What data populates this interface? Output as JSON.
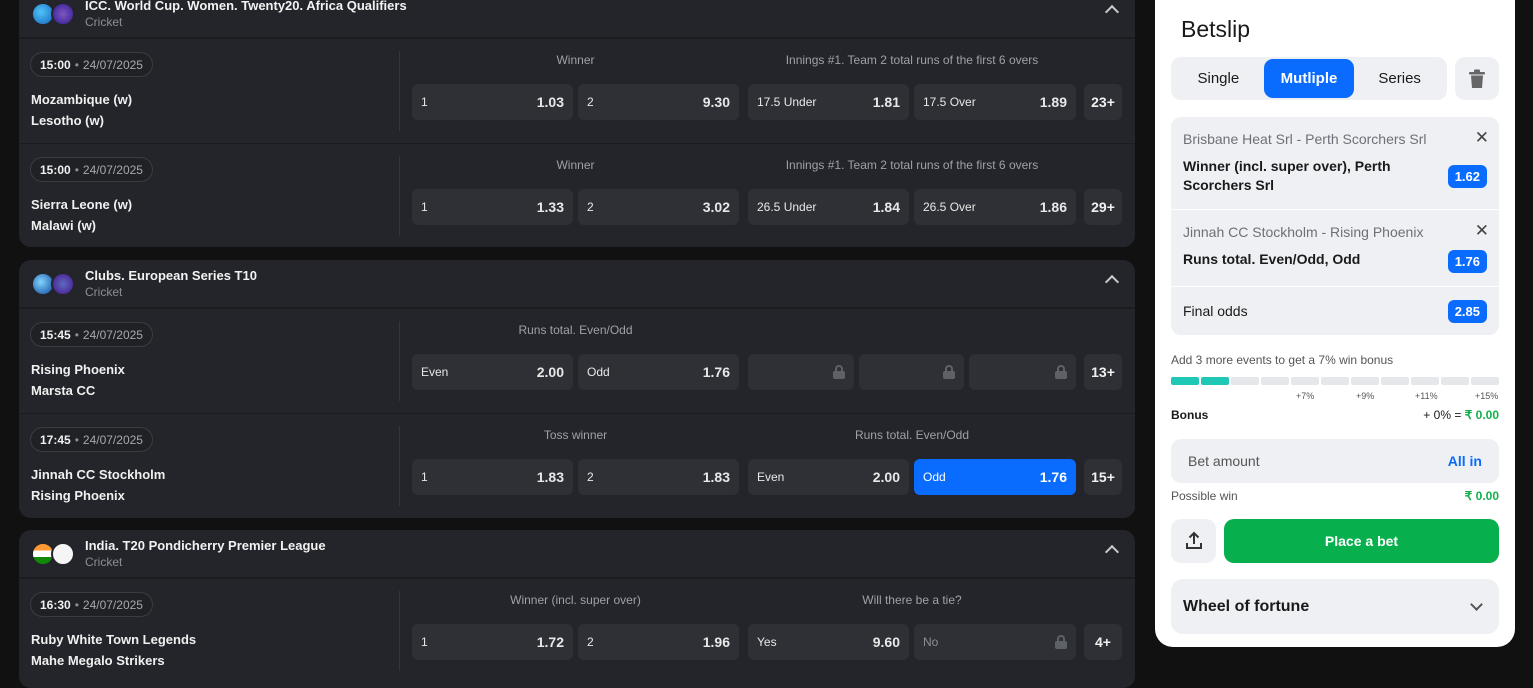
{
  "leagues": [
    {
      "name": "ICC. World Cup. Women. Twenty20. Africa Qualifiers",
      "sport": "Cricket",
      "matches": [
        {
          "time": "15:00",
          "date": "24/07/2025",
          "team1": "Mozambique (w)",
          "team2": "Lesotho (w)",
          "market1": "Winner",
          "market2": "Innings #1. Team 2 total runs of the first 6 overs",
          "odds": [
            {
              "label": "1",
              "value": "1.03"
            },
            {
              "label": "2",
              "value": "9.30"
            },
            {
              "label": "17.5 Under",
              "value": "1.81"
            },
            {
              "label": "17.5 Over",
              "value": "1.89"
            }
          ],
          "more": "23+"
        },
        {
          "time": "15:00",
          "date": "24/07/2025",
          "team1": "Sierra Leone (w)",
          "team2": "Malawi (w)",
          "market1": "Winner",
          "market2": "Innings #1. Team 2 total runs of the first 6 overs",
          "odds": [
            {
              "label": "1",
              "value": "1.33"
            },
            {
              "label": "2",
              "value": "3.02"
            },
            {
              "label": "26.5 Under",
              "value": "1.84"
            },
            {
              "label": "26.5 Over",
              "value": "1.86"
            }
          ],
          "more": "29+"
        }
      ]
    },
    {
      "name": "Clubs. European Series T10",
      "sport": "Cricket",
      "matches": [
        {
          "time": "15:45",
          "date": "24/07/2025",
          "team1": "Rising Phoenix",
          "team2": "Marsta CC",
          "market1": "Runs total. Even/Odd",
          "odds": [
            {
              "label": "Even",
              "value": "2.00"
            },
            {
              "label": "Odd",
              "value": "1.76"
            }
          ],
          "more": "13+"
        },
        {
          "time": "17:45",
          "date": "24/07/2025",
          "team1": "Jinnah CC Stockholm",
          "team2": "Rising Phoenix",
          "market1": "Toss winner",
          "market2": "Runs total. Even/Odd",
          "odds": [
            {
              "label": "1",
              "value": "1.83"
            },
            {
              "label": "2",
              "value": "1.83"
            },
            {
              "label": "Even",
              "value": "2.00"
            },
            {
              "label": "Odd",
              "value": "1.76"
            }
          ],
          "more": "15+"
        }
      ]
    },
    {
      "name": "India. T20 Pondicherry Premier League",
      "sport": "Cricket",
      "matches": [
        {
          "time": "16:30",
          "date": "24/07/2025",
          "team1": "Ruby White Town Legends",
          "team2": "Mahe Megalo Strikers",
          "market1": "Winner (incl. super over)",
          "market2": "Will there be a tie?",
          "odds": [
            {
              "label": "1",
              "value": "1.72"
            },
            {
              "label": "2",
              "value": "1.96"
            },
            {
              "label": "Yes",
              "value": "9.60"
            },
            {
              "label": "No",
              "value": ""
            }
          ],
          "more": "4+"
        }
      ]
    }
  ],
  "betslip": {
    "title": "Betslip",
    "tabs": [
      "Single",
      "Mutliple",
      "Series"
    ],
    "active_tab": "Mutliple",
    "bets": [
      {
        "event": "Brisbane Heat Srl - Perth Scorchers Srl",
        "market": "Winner (incl. super over), Perth Scorchers Srl",
        "odds": "1.62"
      },
      {
        "event": "Jinnah CC Stockholm - Rising Phoenix",
        "market": "Runs total. Even/Odd, Odd",
        "odds": "1.76"
      }
    ],
    "final_label": "Final odds",
    "final_odds": "2.85",
    "bonus_hint": "Add 3 more events to get a 7% win bonus",
    "progress_filled": 2,
    "progress_total": 11,
    "ticks": [
      "+7%",
      "+9%",
      "+11%",
      "+15%"
    ],
    "bonus_label": "Bonus",
    "bonus_pct": "+ 0% =",
    "bonus_value": "₹ 0.00",
    "amount_placeholder": "Bet amount",
    "all_in": "All in",
    "possible_label": "Possible win",
    "possible_value": "₹ 0.00",
    "place_label": "Place a bet",
    "wheel_label": "Wheel of fortune"
  },
  "colors": {
    "accent": "#0a6cff",
    "success": "#08b04d",
    "progress": "#1ec8b4"
  }
}
